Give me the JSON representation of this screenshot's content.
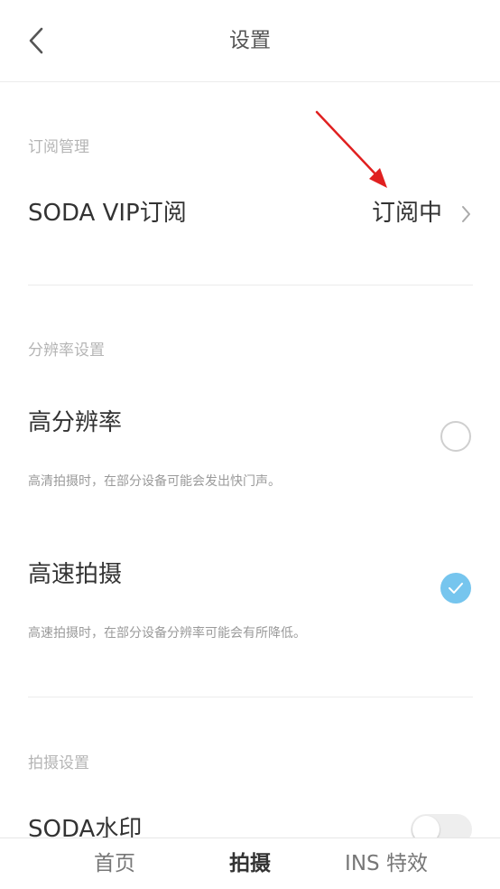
{
  "header": {
    "title": "设置"
  },
  "sections": {
    "subscription": {
      "label": "订阅管理",
      "vip_title": "SODA VIP订阅",
      "vip_status": "订阅中"
    },
    "resolution": {
      "label": "分辨率设置",
      "high_res_title": "高分辨率",
      "high_res_desc": "高清拍摄时，在部分设备可能会发出快门声。",
      "high_res_selected": false,
      "high_speed_title": "高速拍摄",
      "high_speed_desc": "高速拍摄时，在部分设备分辨率可能会有所降低。",
      "high_speed_selected": true
    },
    "capture": {
      "label": "拍摄设置",
      "watermark_title": "SODA水印",
      "watermark_enabled": false
    }
  },
  "bottom_nav": {
    "tabs": [
      {
        "label": "首页",
        "active": false
      },
      {
        "label": "拍摄",
        "active": true
      },
      {
        "label": "INS 特效",
        "active": false
      }
    ]
  },
  "colors": {
    "accent": "#76c5ee",
    "annotation_arrow": "#e02020",
    "divider": "#ececec"
  },
  "icons": {
    "back": "chevron-left-icon",
    "vip_chevron": "chevron-right-icon",
    "check": "check-icon"
  }
}
